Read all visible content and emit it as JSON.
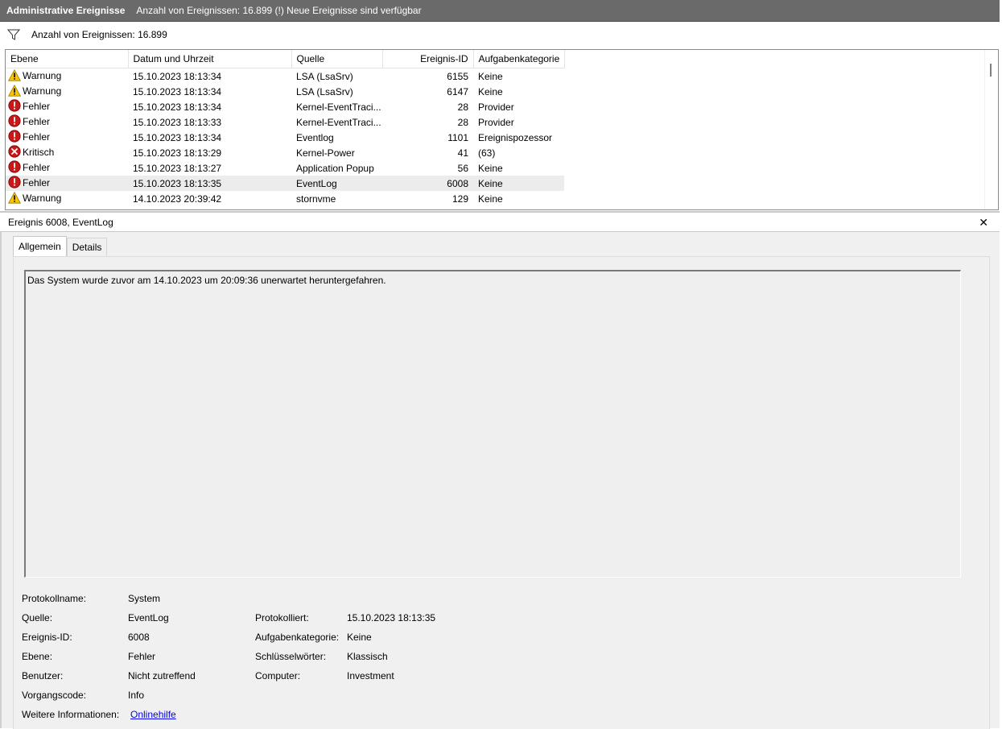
{
  "titlebar": {
    "title": "Administrative Ereignisse",
    "subtitle": "Anzahl von Ereignissen: 16.899 (!) Neue Ereignisse sind verfügbar"
  },
  "filterbar": {
    "icon": "filter-icon",
    "count_label": "Anzahl von Ereignissen: 16.899"
  },
  "grid": {
    "columns": [
      "Ebene",
      "Datum und Uhrzeit",
      "Quelle",
      "Ereignis-ID",
      "Aufgabenkategorie"
    ],
    "rows": [
      {
        "level": "Warnung",
        "icon": "warning-icon",
        "date": "15.10.2023 18:13:34",
        "source": "LSA (LsaSrv)",
        "id": "6155",
        "category": "Keine"
      },
      {
        "level": "Warnung",
        "icon": "warning-icon",
        "date": "15.10.2023 18:13:34",
        "source": "LSA (LsaSrv)",
        "id": "6147",
        "category": "Keine"
      },
      {
        "level": "Fehler",
        "icon": "error-icon",
        "date": "15.10.2023 18:13:34",
        "source": "Kernel-EventTraci...",
        "id": "28",
        "category": "Provider"
      },
      {
        "level": "Fehler",
        "icon": "error-icon",
        "date": "15.10.2023 18:13:33",
        "source": "Kernel-EventTraci...",
        "id": "28",
        "category": "Provider"
      },
      {
        "level": "Fehler",
        "icon": "error-icon",
        "date": "15.10.2023 18:13:34",
        "source": "Eventlog",
        "id": "1101",
        "category": "Ereignispozessor"
      },
      {
        "level": "Kritisch",
        "icon": "critical-icon",
        "date": "15.10.2023 18:13:29",
        "source": "Kernel-Power",
        "id": "41",
        "category": "(63)"
      },
      {
        "level": "Fehler",
        "icon": "error-icon",
        "date": "15.10.2023 18:13:27",
        "source": "Application Popup",
        "id": "56",
        "category": "Keine"
      },
      {
        "level": "Fehler",
        "icon": "error-icon",
        "date": "15.10.2023 18:13:35",
        "source": "EventLog",
        "id": "6008",
        "category": "Keine",
        "selected": true
      },
      {
        "level": "Warnung",
        "icon": "warning-icon",
        "date": "14.10.2023 20:39:42",
        "source": "stornvme",
        "id": "129",
        "category": "Keine"
      }
    ]
  },
  "detail": {
    "header": "Ereignis 6008, EventLog",
    "close": "✕",
    "tabs": [
      "Allgemein",
      "Details"
    ],
    "description": "Das System wurde zuvor am 14.10.2023 um 20:09:36 unerwartet heruntergefahren.",
    "props": {
      "protokollname_label": "Protokollname:",
      "protokollname_value": "System",
      "quelle_label": "Quelle:",
      "quelle_value": "EventLog",
      "protokolliert_label": "Protokolliert:",
      "protokolliert_value": "15.10.2023 18:13:35",
      "ereignisid_label": "Ereignis-ID:",
      "ereignisid_value": "6008",
      "aufgabenkategorie_label": "Aufgabenkategorie:",
      "aufgabenkategorie_value": "Keine",
      "ebene_label": "Ebene:",
      "ebene_value": "Fehler",
      "schluesselwoerter_label": "Schlüsselwörter:",
      "schluesselwoerter_value": "Klassisch",
      "benutzer_label": "Benutzer:",
      "benutzer_value": "Nicht zutreffend",
      "computer_label": "Computer:",
      "computer_value": "Investment",
      "vorgangscode_label": "Vorgangscode:",
      "vorgangscode_value": "Info",
      "weitere_label": "Weitere Informationen:",
      "weitere_link": "Onlinehilfe"
    }
  }
}
